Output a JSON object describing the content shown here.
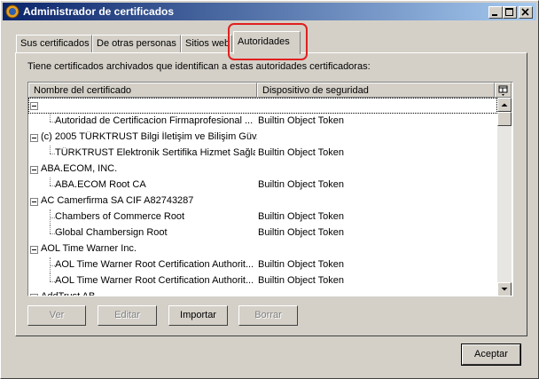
{
  "window": {
    "title": "Administrador de certificados"
  },
  "tabs": [
    {
      "label": "Sus certificados"
    },
    {
      "label": "De otras personas"
    },
    {
      "label": "Sitios web"
    },
    {
      "label": "Autoridades",
      "active": true
    }
  ],
  "panel": {
    "description": "Tiene certificados archivados que identifican a estas autoridades certificadoras:"
  },
  "table": {
    "columns": [
      "Nombre del certificado",
      "Dispositivo de seguridad"
    ],
    "rows": [
      {
        "level": 0,
        "name": "",
        "device": ""
      },
      {
        "level": 1,
        "name": "Autoridad de Certificacion Firmaprofesional ...",
        "device": "Builtin Object Token"
      },
      {
        "level": 0,
        "name": "(c) 2005 TÜRKTRUST Bilgi İletişim ve Bilişim Güv...",
        "device": ""
      },
      {
        "level": 1,
        "name": "TÜRKTRUST Elektronik Sertifika Hizmet Sağla...",
        "device": "Builtin Object Token"
      },
      {
        "level": 0,
        "name": "ABA.ECOM, INC.",
        "device": ""
      },
      {
        "level": 1,
        "name": "ABA.ECOM Root CA",
        "device": "Builtin Object Token"
      },
      {
        "level": 0,
        "name": "AC Camerfirma SA CIF A82743287",
        "device": ""
      },
      {
        "level": 1,
        "name": "Chambers of Commerce Root",
        "device": "Builtin Object Token"
      },
      {
        "level": 1,
        "name": "Global Chambersign Root",
        "device": "Builtin Object Token"
      },
      {
        "level": 0,
        "name": "AOL Time Warner Inc.",
        "device": ""
      },
      {
        "level": 1,
        "name": "AOL Time Warner Root Certification Authorit...",
        "device": "Builtin Object Token"
      },
      {
        "level": 1,
        "name": "AOL Time Warner Root Certification Authorit...",
        "device": "Builtin Object Token"
      },
      {
        "level": 0,
        "name": "AddTrust AB",
        "device": ""
      }
    ]
  },
  "buttons": {
    "view": "Ver",
    "edit": "Editar",
    "import": "Importar",
    "delete": "Borrar",
    "accept": "Aceptar"
  }
}
